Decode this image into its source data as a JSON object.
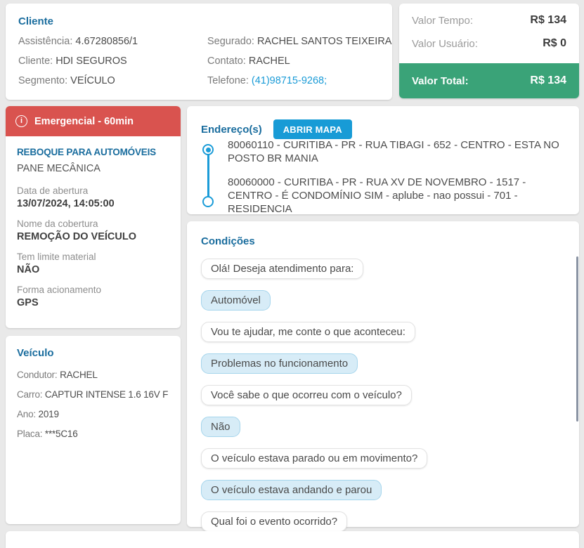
{
  "colors": {
    "accent_blue_heading": "#1a6d9e",
    "link_blue": "#1a9bd7",
    "button_blue": "#189bd6",
    "timeline_blue": "#1b9cd8",
    "emergency_red": "#d9534f",
    "total_green": "#3aa378",
    "user_bubble_bg": "#d7ecf7",
    "user_bubble_border": "#a5d5ec",
    "page_background": "#e9e9e9"
  },
  "cliente": {
    "title": "Cliente",
    "assistencia_label": "Assistência:",
    "assistencia_value": "4.67280856/1",
    "cliente_label": "Cliente:",
    "cliente_value": "HDI SEGUROS",
    "segmento_label": "Segmento:",
    "segmento_value": "VEÍCULO",
    "segurado_label": "Segurado:",
    "segurado_value": "RACHEL SANTOS TEIXEIRA",
    "contato_label": "Contato:",
    "contato_value": "RACHEL",
    "telefone_label": "Telefone:",
    "telefone_value": "(41)98715-9268;"
  },
  "valores": {
    "tempo_label": "Valor Tempo:",
    "tempo_value": "R$ 134",
    "usuario_label": "Valor Usuário:",
    "usuario_value": "R$ 0",
    "total_label": "Valor Total:",
    "total_value": "R$ 134"
  },
  "servico": {
    "header": "Emergencial - 60min",
    "info_icon_glyph": "i",
    "title": "REBOQUE PARA AUTOMÓVEIS",
    "subtitle": "PANE MECÂNICA",
    "fields": [
      {
        "label": "Data de abertura",
        "value": "13/07/2024, 14:05:00"
      },
      {
        "label": "Nome da cobertura",
        "value": "REMOÇÃO DO VEÍCULO"
      },
      {
        "label": "Tem limite material",
        "value": "NÃO"
      },
      {
        "label": "Forma acionamento",
        "value": "GPS"
      }
    ]
  },
  "veiculo": {
    "title": "Veículo",
    "condutor_label": "Condutor:",
    "condutor_value": "RACHEL",
    "carro_label": "Carro:",
    "carro_value": "CAPTUR INTENSE 1.6 16V F",
    "ano_label": "Ano:",
    "ano_value": "2019",
    "placa_label": "Placa:",
    "placa_value": "***5C16"
  },
  "enderecos": {
    "title": "Endereço(s)",
    "map_button": "ABRIR MAPA",
    "origem": "80060110 - CURITIBA - PR - RUA TIBAGI - 652 - CENTRO - ESTA NO POSTO BR MANIA",
    "destino": "80060000 - CURITIBA - PR - RUA XV DE NOVEMBRO - 1517 - CENTRO - É CONDOMÍNIO SIM - aplube - nao possui - 701 - RESIDENCIA"
  },
  "condicoes": {
    "title": "Condições",
    "messages": [
      {
        "type": "bot",
        "text": "Olá! Deseja atendimento para:"
      },
      {
        "type": "user",
        "text": "Automóvel"
      },
      {
        "type": "bot",
        "text": "Vou te ajudar, me conte o que aconteceu:"
      },
      {
        "type": "user",
        "text": "Problemas no funcionamento"
      },
      {
        "type": "bot",
        "text": "Você sabe o que ocorreu com o veículo?"
      },
      {
        "type": "user",
        "text": "Não"
      },
      {
        "type": "bot",
        "text": "O veículo estava parado ou em movimento?"
      },
      {
        "type": "user",
        "text": "O veículo estava andando e parou"
      },
      {
        "type": "bot",
        "text": "Qual foi o evento ocorrido?"
      }
    ]
  }
}
